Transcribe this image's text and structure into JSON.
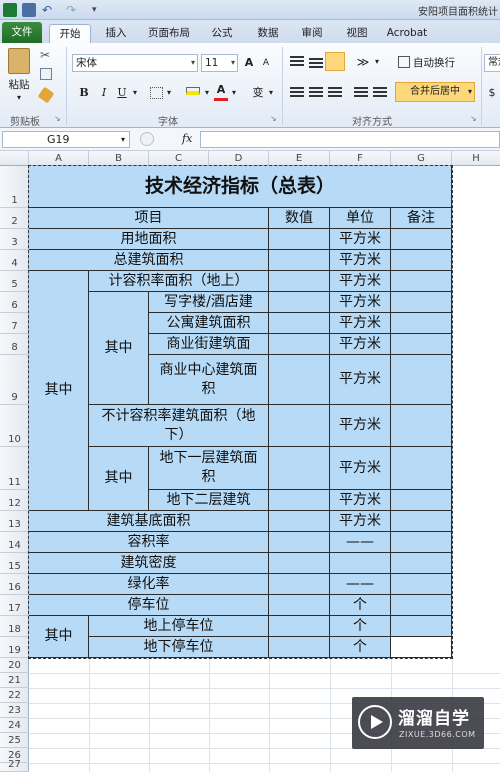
{
  "window": {
    "title": "安阳项目面积统计"
  },
  "tabs": [
    {
      "label": "文件"
    },
    {
      "label": "开始"
    },
    {
      "label": "插入"
    },
    {
      "label": "页面布局"
    },
    {
      "label": "公式"
    },
    {
      "label": "数据"
    },
    {
      "label": "审阅"
    },
    {
      "label": "视图"
    },
    {
      "label": "Acrobat"
    }
  ],
  "ribbon": {
    "paste_label": "粘贴",
    "font_name": "宋体",
    "font_size": "11",
    "bold": "B",
    "italic": "I",
    "underline": "U",
    "font_color_glyph": "A",
    "phonetic_glyph": "变",
    "grow_font": "A",
    "shrink_font": "A",
    "wrap_text": "自动换行",
    "merge_center": "合并后居中",
    "number_format": "常规",
    "currency": "$",
    "groups": {
      "clipboard": "剪贴板",
      "font": "字体",
      "alignment": "对齐方式"
    }
  },
  "formula_bar": {
    "name_box": "G19",
    "fx": "fx",
    "content": ""
  },
  "columns": [
    "A",
    "B",
    "C",
    "D",
    "E",
    "F",
    "G",
    "H"
  ],
  "rows": [
    "1",
    "2",
    "3",
    "4",
    "5",
    "6",
    "7",
    "8",
    "9",
    "10",
    "11",
    "12",
    "13",
    "14",
    "15",
    "16",
    "17",
    "18",
    "19",
    "20",
    "21",
    "22",
    "23",
    "24",
    "25",
    "26",
    "27"
  ],
  "table": {
    "title": "技术经济指标（总表）",
    "header": {
      "item": "项目",
      "value": "数值",
      "unit": "单位",
      "note": "备注"
    },
    "r3": {
      "item": "用地面积",
      "unit": "平方米"
    },
    "r4": {
      "item": "总建筑面积",
      "unit": "平方米"
    },
    "group_label": "其中",
    "r5": {
      "item": "计容积率面积（地上）",
      "unit": "平方米"
    },
    "sub_label_a": "其中",
    "r6": {
      "item": "写字楼/酒店建",
      "unit": "平方米"
    },
    "r7": {
      "item": "公寓建筑面积",
      "unit": "平方米"
    },
    "r8": {
      "item": "商业街建筑面",
      "unit": "平方米"
    },
    "r9": {
      "item": "商业中心建筑面积",
      "unit": "平方米"
    },
    "r10": {
      "item": "不计容积率建筑面积（地下）",
      "unit": "平方米"
    },
    "sub_label_b": "其中",
    "r11": {
      "item": "地下一层建筑面积",
      "unit": "平方米"
    },
    "r12": {
      "item": "地下二层建筑",
      "unit": "平方米"
    },
    "r13": {
      "item": "建筑基底面积",
      "unit": "平方米"
    },
    "r14": {
      "item": "容积率",
      "unit": "——"
    },
    "r15": {
      "item": "建筑密度",
      "unit": ""
    },
    "r16": {
      "item": "绿化率",
      "unit": "——"
    },
    "r17": {
      "item": "停车位",
      "unit": "个"
    },
    "park_label": "其中",
    "r18": {
      "item": "地上停车位",
      "unit": "个"
    },
    "r19": {
      "item": "地下停车位",
      "unit": "个"
    }
  },
  "watermark": {
    "brand": "溜溜自学",
    "site": "ZIXUE.3D66.COM"
  },
  "colors": {
    "cell_fill": "#b7dbf7",
    "file_tab": "#1f6d26",
    "ribbon_bg": "#e3ebf6"
  }
}
